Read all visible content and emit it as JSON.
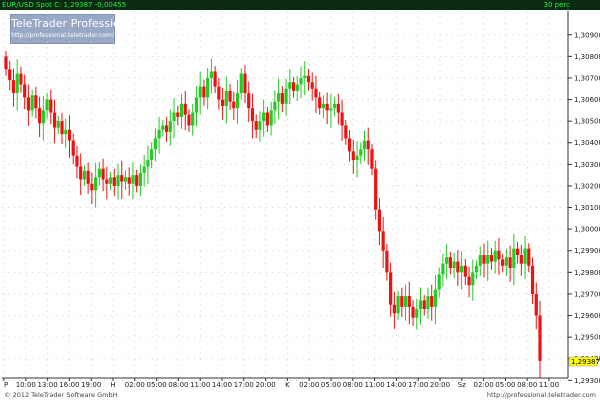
{
  "header": {
    "symbol_text": "EUR/USD Spot C: 1,29387 -0,00455",
    "interval_text": "30 perc"
  },
  "logo": {
    "title": "TeleTrader Professional",
    "url": "http://professional.teletrader.com/"
  },
  "footer": {
    "copyright": "© 2012 TeleTrader Software GmbH",
    "url": "http://professional.teletrader.com"
  },
  "colors": {
    "up": "#22cc22",
    "down": "#ee1111",
    "grid": "#c8c8c8",
    "top_bar": "#0a2a12",
    "badge": "#ffff00"
  },
  "chart_data": {
    "type": "candlestick",
    "title": "",
    "xlabel": "",
    "ylabel": "",
    "ylim": [
      1.2932,
      1.3101
    ],
    "y_ticks": [
      "1,30900",
      "1,30800",
      "1,30700",
      "1,30600",
      "1,30500",
      "1,30400",
      "1,30300",
      "1,30200",
      "1,30100",
      "1,30000",
      "1,29900",
      "1,29800",
      "1,29700",
      "1,29600",
      "1,29500",
      "1,29400",
      "1,29300"
    ],
    "x_ticks": [
      "P",
      "10:00",
      "13:00",
      "16:00",
      "19:00",
      "H",
      "02:00",
      "05:00",
      "08:00",
      "11:00",
      "14:00",
      "17:00",
      "20:00",
      "K",
      "02:00",
      "05:00",
      "08:00",
      "11:00",
      "14:00",
      "17:00",
      "20:00",
      "Sz",
      "02:00",
      "05:00",
      "08:00",
      "11:00"
    ],
    "last_price": "1,29387",
    "grid": true,
    "closes": [
      1.3074,
      1.3069,
      1.3063,
      1.3072,
      1.3067,
      1.3061,
      1.3055,
      1.3062,
      1.3056,
      1.3049,
      1.3055,
      1.306,
      1.3054,
      1.3047,
      1.305,
      1.3044,
      1.3046,
      1.3041,
      1.3034,
      1.3029,
      1.3023,
      1.3027,
      1.3021,
      1.3018,
      1.3024,
      1.3028,
      1.3023,
      1.3021,
      1.3024,
      1.302,
      1.3025,
      1.3022,
      1.3024,
      1.3021,
      1.3025,
      1.302,
      1.3026,
      1.3029,
      1.3032,
      1.3037,
      1.3042,
      1.3046,
      1.3048,
      1.3045,
      1.305,
      1.3054,
      1.3052,
      1.3058,
      1.3053,
      1.3048,
      1.3054,
      1.3061,
      1.3066,
      1.3061,
      1.307,
      1.3073,
      1.3066,
      1.306,
      1.3057,
      1.3064,
      1.3059,
      1.3056,
      1.3063,
      1.3072,
      1.3063,
      1.3056,
      1.305,
      1.3046,
      1.305,
      1.3054,
      1.3048,
      1.3055,
      1.3059,
      1.3063,
      1.3058,
      1.3065,
      1.3068,
      1.3064,
      1.3067,
      1.307,
      1.3071,
      1.3068,
      1.3065,
      1.3061,
      1.3056,
      1.3058,
      1.3055,
      1.3056,
      1.3058,
      1.3054,
      1.3048,
      1.3042,
      1.3036,
      1.3032,
      1.3034,
      1.3037,
      1.3041,
      1.3037,
      1.3028,
      1.3009,
      1.2999,
      1.299,
      1.298,
      1.2965,
      1.2961,
      1.2969,
      1.2964,
      1.2969,
      1.2964,
      1.2959,
      1.2963,
      1.2967,
      1.2963,
      1.2969,
      1.2964,
      1.2972,
      1.2979,
      1.2984,
      1.2987,
      1.2982,
      1.2985,
      1.298,
      1.2983,
      1.2978,
      1.2974,
      1.298,
      1.2983,
      1.2988,
      1.2984,
      1.2988,
      1.2985,
      1.299,
      1.2986,
      1.2983,
      1.2987,
      1.2982,
      1.2991,
      1.2988,
      1.2984,
      1.2991,
      1.2983,
      1.297,
      1.296,
      1.2939
    ],
    "series": [
      {
        "name": "EUR/USD Spot"
      }
    ]
  }
}
